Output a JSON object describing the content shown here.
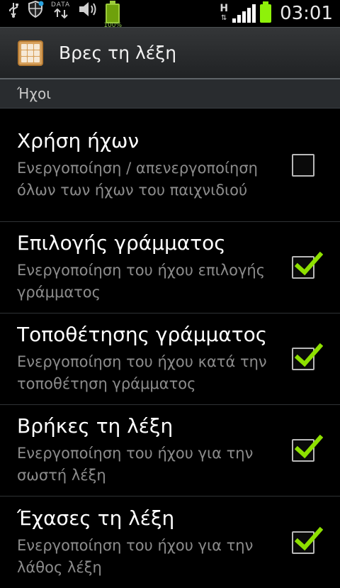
{
  "status_bar": {
    "data_label": "DATA",
    "battery_small_text": "100%",
    "network_type": "H",
    "time": "03:01"
  },
  "title_bar": {
    "title": "Βρες τη λέξη",
    "icon": "app-grid-icon"
  },
  "section": {
    "label": "Ήχοι"
  },
  "preferences": [
    {
      "title": "Χρήση ήχων",
      "summary": "Ενεργοποίηση / απενεργοποίηση όλων των ήχων του παιχνιδιού",
      "checked": false
    },
    {
      "title": "Επιλογής γράμματος",
      "summary": "Ενεργοποίηση του ήχου επιλογής γράμματος",
      "checked": true
    },
    {
      "title": "Τοποθέτησης γράμματος",
      "summary": "Ενεργοποίηση του ήχου κατά την τοποθέτηση γράμματος",
      "checked": true
    },
    {
      "title": "Βρήκες τη λέξη",
      "summary": "Ενεργοποίηση του ήχου για την σωστή λέξη",
      "checked": true
    },
    {
      "title": "Έχασες τη λέξη",
      "summary": "Ενεργοποίηση του ήχου για την λάθος λέξη",
      "checked": true
    }
  ],
  "colors": {
    "check_green": "#8ee000",
    "battery_green": "#8ef10a"
  }
}
